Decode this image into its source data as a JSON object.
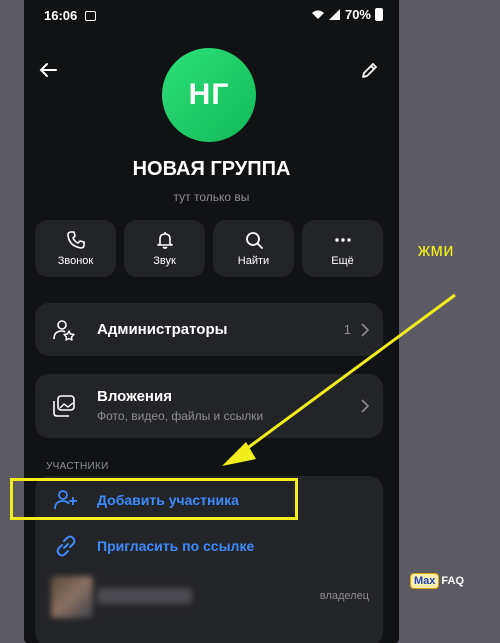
{
  "status_bar": {
    "time": "16:06",
    "battery": "70%"
  },
  "header": {
    "avatar_initials": "НГ",
    "title": "НОВАЯ ГРУППА",
    "subtitle": "тут только вы"
  },
  "actions": [
    {
      "label": "Звонок",
      "icon": "phone-icon"
    },
    {
      "label": "Звук",
      "icon": "bell-icon"
    },
    {
      "label": "Найти",
      "icon": "search-icon"
    },
    {
      "label": "Ещё",
      "icon": "more-icon"
    }
  ],
  "admins": {
    "label": "Администраторы",
    "count": "1"
  },
  "attachments": {
    "label": "Вложения",
    "sublabel": "Фото, видео, файлы и ссылки"
  },
  "members": {
    "section_label": "УЧАСТНИКИ",
    "add_label": "Добавить участника",
    "invite_label": "Пригласить по ссылке",
    "owner_role": "владелец"
  },
  "annotation": {
    "text": "жми"
  },
  "watermark": {
    "brand_a": "Max",
    "brand_b": "FAQ"
  }
}
